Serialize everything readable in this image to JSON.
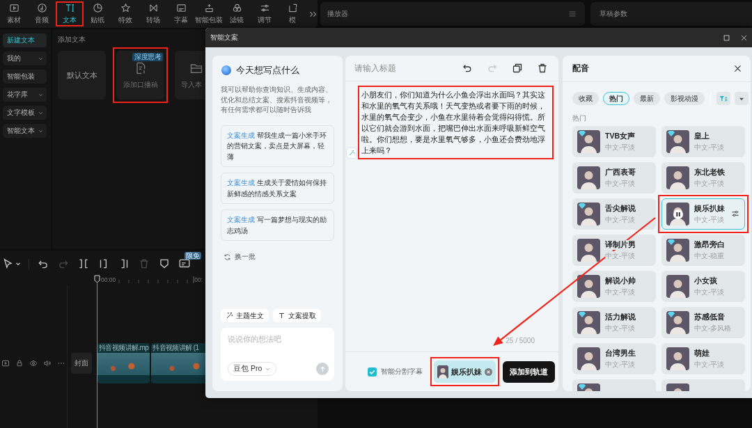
{
  "toolbar": {
    "tabs": [
      {
        "label": "素材",
        "selected": false,
        "highlighted": false
      },
      {
        "label": "音频",
        "selected": false,
        "highlighted": false
      },
      {
        "label": "文本",
        "selected": true,
        "highlighted": true
      },
      {
        "label": "贴纸",
        "selected": false,
        "highlighted": false
      },
      {
        "label": "特效",
        "selected": false,
        "highlighted": false
      },
      {
        "label": "转场",
        "selected": false,
        "highlighted": false
      },
      {
        "label": "字幕",
        "selected": false,
        "highlighted": false
      },
      {
        "label": "智能包装",
        "selected": false,
        "highlighted": false
      },
      {
        "label": "滤镜",
        "selected": false,
        "highlighted": false
      },
      {
        "label": "调节",
        "selected": false,
        "highlighted": false
      },
      {
        "label": "模",
        "selected": false,
        "highlighted": false
      }
    ]
  },
  "player": {
    "title": "播放器"
  },
  "draft": {
    "title": "草稿参数"
  },
  "sidebar": {
    "items": [
      {
        "label": "新建文本",
        "selected": true,
        "expandable": false
      },
      {
        "label": "我的",
        "selected": false,
        "expandable": true
      },
      {
        "label": "智能包装",
        "selected": false,
        "expandable": false
      },
      {
        "label": "花字库",
        "selected": false,
        "expandable": true
      },
      {
        "label": "文字模板",
        "selected": false,
        "expandable": true
      },
      {
        "label": "智能文本",
        "selected": false,
        "expandable": true
      }
    ]
  },
  "text_panel": {
    "heading": "添加文本",
    "cards": [
      {
        "kind": "plain",
        "label": "默认文本",
        "highlighted": false
      },
      {
        "kind": "script",
        "label": "添加口播稿",
        "badge": "深度思考",
        "highlighted": true
      },
      {
        "kind": "import",
        "label": "导入本",
        "highlighted": false
      }
    ]
  },
  "timeline": {
    "tools": [
      {
        "disabled": false
      },
      {
        "disabled": false
      },
      {
        "disabled": true
      },
      {
        "disabled": false
      },
      {
        "disabled": false
      },
      {
        "disabled": false
      },
      {
        "disabled": true
      },
      {
        "disabled": false
      },
      {
        "disabled": false,
        "badge": "限免"
      }
    ],
    "ruler": [
      "00:00",
      "00:"
    ],
    "track": {
      "cover": "封面",
      "clips": [
        {
          "label": "抖音视频讲解.mp"
        },
        {
          "label": "抖音视频讲解 (1"
        }
      ]
    }
  },
  "dialog": {
    "title": "智能文案",
    "assistant": {
      "greeting": "今天想写点什么",
      "intro": "我可以帮助你查询知识、生成内容、优化和总结文案、搜索抖音视频等，有任何需求都可以随时告诉我",
      "suggestions": [
        {
          "tag": "文案生成",
          "text": "帮我生成一篇小米手环的营销文案，卖点是大屏幕，轻薄"
        },
        {
          "tag": "文案生成",
          "text": "生成关于爱情如何保持新鲜感的情感关系文案"
        },
        {
          "tag": "文案生成",
          "text": "写一篇梦想与现实的励志鸡汤"
        }
      ],
      "refresh": "换一批",
      "actions": [
        "主题生文",
        "文案提取"
      ],
      "input": {
        "placeholder": "说说你的想法吧",
        "model": "豆包 Pro"
      }
    },
    "editor": {
      "title_placeholder": "请输入标题",
      "redo_disabled": true,
      "body": "小朋友们，你们知道为什么小鱼会浮出水面吗？其实这和水里的氧气有关系哦！天气变热或者要下雨的时候，水里的氧气会变少，小鱼在水里待着会觉得闷得慌。所以它们就会游到水面，把嘴巴伸出水面来呼吸新鲜空气啦。你们想想，要是水里氧气够多，小鱼还会费劲地浮上来吗？",
      "highlighted": true,
      "counter": "25 / 5000",
      "smart_split": {
        "label": "智能分割字幕",
        "checked": true
      },
      "voice_chip": {
        "name": "娱乐扒妹",
        "highlighted": true
      },
      "submit": "添加到轨道"
    },
    "voice_panel": {
      "title": "配音",
      "filters": [
        {
          "label": "收藏",
          "selected": false
        },
        {
          "label": "热门",
          "selected": true
        },
        {
          "label": "最新",
          "selected": false
        },
        {
          "label": "影视动漫",
          "selected": false
        }
      ],
      "section": "热门",
      "voices": [
        {
          "name": "TVB女声",
          "style": "中文-平淡",
          "premium": true,
          "selected": false,
          "playing": false,
          "highlighted": false
        },
        {
          "name": "皇上",
          "style": "中文-平淡",
          "premium": true,
          "selected": false,
          "playing": false,
          "highlighted": false
        },
        {
          "name": "广西表哥",
          "style": "中文-平淡",
          "premium": false,
          "selected": false,
          "playing": false,
          "highlighted": false
        },
        {
          "name": "东北老铁",
          "style": "中文-平淡",
          "premium": false,
          "selected": false,
          "playing": false,
          "highlighted": false
        },
        {
          "name": "舌尖解说",
          "style": "中文-平淡",
          "premium": true,
          "selected": false,
          "playing": false,
          "highlighted": false
        },
        {
          "name": "娱乐扒妹",
          "style": "中文-平淡",
          "premium": false,
          "selected": true,
          "playing": true,
          "highlighted": true
        },
        {
          "name": "译制片男",
          "style": "中文-平淡",
          "premium": false,
          "selected": false,
          "playing": false,
          "highlighted": false
        },
        {
          "name": "激昂旁白",
          "style": "中文-稳重",
          "premium": true,
          "selected": false,
          "playing": false,
          "highlighted": false
        },
        {
          "name": "解说小帅",
          "style": "中文-平淡",
          "premium": false,
          "selected": false,
          "playing": false,
          "highlighted": false
        },
        {
          "name": "小女孩",
          "style": "中文-平淡",
          "premium": false,
          "selected": false,
          "playing": false,
          "highlighted": false
        },
        {
          "name": "活力解说",
          "style": "中文-平淡",
          "premium": true,
          "selected": false,
          "playing": false,
          "highlighted": false
        },
        {
          "name": "苏感低音",
          "style": "中文-多风格",
          "premium": true,
          "selected": false,
          "playing": false,
          "highlighted": false
        },
        {
          "name": "台湾男生",
          "style": "中文-平淡",
          "premium": false,
          "selected": false,
          "playing": false,
          "highlighted": false
        },
        {
          "name": "萌娃",
          "style": "中文-平淡",
          "premium": false,
          "selected": false,
          "playing": false,
          "highlighted": false
        },
        {
          "premium": true,
          "selected": false,
          "playing": false,
          "highlighted": false
        },
        {
          "premium": false,
          "selected": false,
          "playing": false,
          "highlighted": false
        }
      ]
    }
  },
  "annotation": {
    "arrow": true
  }
}
